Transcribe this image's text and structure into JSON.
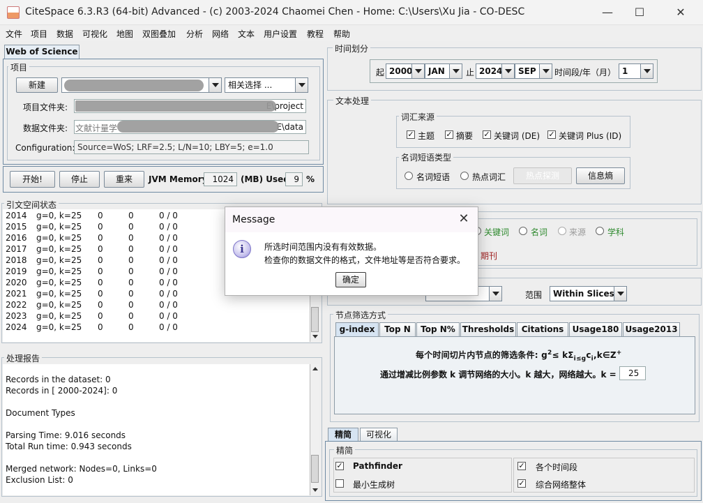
{
  "window": {
    "title": "CiteSpace 6.3.R3 (64-bit) Advanced - (c) 2003-2024 Chaomei Chen - Home: C:\\Users\\Xu Jia - CO-DESC",
    "minimize": "—",
    "maximize": "☐",
    "close": "✕"
  },
  "menu": [
    "文件",
    "项目",
    "数据",
    "可视化",
    "地图",
    "双图叠加",
    "分析",
    "网络",
    "文本",
    "用户设置",
    "教程",
    "帮助"
  ],
  "left": {
    "tab": "Web of Science",
    "project_group": "项目",
    "new_button": "新建",
    "selection_combo": "相关选择 ...",
    "project_dir_label": "项目文件夹:",
    "project_dir_value": "E\\project",
    "data_dir_label": "数据文件夹:",
    "data_dir_prefix": "文献计量学",
    "data_dir_value": "E\\data",
    "config_label": "Configuration:",
    "config_value": "Source=WoS; LRF=2.5; L/N=10; LBY=5; e=1.0",
    "start_button": "开始!",
    "stop_button": "停止",
    "reset_button": "重来",
    "jvm_label": "JVM Memory",
    "jvm_value": "1024",
    "used_label": "(MB) Used",
    "used_value": "9",
    "percent": "%",
    "status_group": "引文空间状态",
    "status_rows": [
      {
        "year": "2014",
        "g": "g=0, k=25",
        "a": "0",
        "b": "0",
        "c": "0 / 0"
      },
      {
        "year": "2015",
        "g": "g=0, k=25",
        "a": "0",
        "b": "0",
        "c": "0 / 0"
      },
      {
        "year": "2016",
        "g": "g=0, k=25",
        "a": "0",
        "b": "0",
        "c": "0 / 0"
      },
      {
        "year": "2017",
        "g": "g=0, k=25",
        "a": "0",
        "b": "0",
        "c": "0 / 0"
      },
      {
        "year": "2018",
        "g": "g=0, k=25",
        "a": "0",
        "b": "0",
        "c": "0 / 0"
      },
      {
        "year": "2019",
        "g": "g=0, k=25",
        "a": "0",
        "b": "0",
        "c": "0 / 0"
      },
      {
        "year": "2020",
        "g": "g=0, k=25",
        "a": "0",
        "b": "0",
        "c": "0 / 0"
      },
      {
        "year": "2021",
        "g": "g=0, k=25",
        "a": "0",
        "b": "0",
        "c": "0 / 0"
      },
      {
        "year": "2022",
        "g": "g=0, k=25",
        "a": "0",
        "b": "0",
        "c": "0 / 0"
      },
      {
        "year": "2023",
        "g": "g=0, k=25",
        "a": "0",
        "b": "0",
        "c": "0 / 0"
      },
      {
        "year": "2024",
        "g": "g=0, k=25",
        "a": "0",
        "b": "0",
        "c": "0 / 0"
      }
    ],
    "report_group": "处理报告",
    "report_lines": [
      "Records in the dataset: 0",
      "Records in [ 2000-2024]: 0",
      "",
      "Document Types",
      "",
      "Parsing Time:   9.016 seconds",
      "Total Run time:  0.943 seconds",
      "",
      "Merged network: Nodes=0, Links=0",
      "Exclusion List: 0"
    ]
  },
  "right": {
    "time_group": "时间划分",
    "from_label": "起",
    "from_year": "2000",
    "from_month": "JAN",
    "to_label": "止",
    "to_year": "2024",
    "to_month": "SEP",
    "slice_label": "时间段/年（月）",
    "slice_value": "1",
    "text_group": "文本处理",
    "term_source_group": "词汇来源",
    "term_sources": [
      {
        "label": "主题",
        "checked": true
      },
      {
        "label": "摘要",
        "checked": true
      },
      {
        "label": "关键词 (DE)",
        "checked": true
      },
      {
        "label": "关键词 Plus (ID)",
        "checked": true
      }
    ],
    "noun_type_group": "名词短语类型",
    "noun_phrase": "名词短语",
    "hot_terms": "热点词汇",
    "burst_button": "热点探测",
    "entropy_button": "信息熵",
    "node_types_partial": [
      {
        "label": "关键词",
        "color": "#2f8a2f"
      },
      {
        "label": "名词",
        "color": "#2f8a2f"
      },
      {
        "label": "来源",
        "color": "#9a9a9a"
      },
      {
        "label": "学科",
        "color": "#2f8a2f"
      }
    ],
    "journal_partial": "期刊",
    "scope_label": "范围",
    "scope_value": "Within Slices",
    "selection_group": "节点筛选方式",
    "selection_tabs": [
      "g-index",
      "Top N",
      "Top N%",
      "Thresholds",
      "Citations",
      "Usage180",
      "Usage2013"
    ],
    "gindex_text1": "每个时间切片内节点的筛选条件: g",
    "gindex_formula": "≤ kΣ",
    "gindex_tail": "k∈Z",
    "gindex_text2": "通过增减比例参数 k 调节网络的大小。k 越大，网络越大。k =",
    "k_value": "25",
    "prune_tabs": [
      "精简",
      "可视化"
    ],
    "prune_group": "精简",
    "prune_options_left": [
      {
        "label": "Pathfinder",
        "checked": true
      },
      {
        "label": "最小生成树",
        "checked": false
      }
    ],
    "prune_options_right": [
      {
        "label": "各个时间段",
        "checked": true
      },
      {
        "label": "综合网络整体",
        "checked": true
      }
    ]
  },
  "dialog": {
    "title": "Message",
    "close": "✕",
    "line1": "所选时间范围内没有有效数据。",
    "line2": "检查你的数据文件的格式，文件地址等是否符合要求。",
    "ok_button": "确定"
  }
}
